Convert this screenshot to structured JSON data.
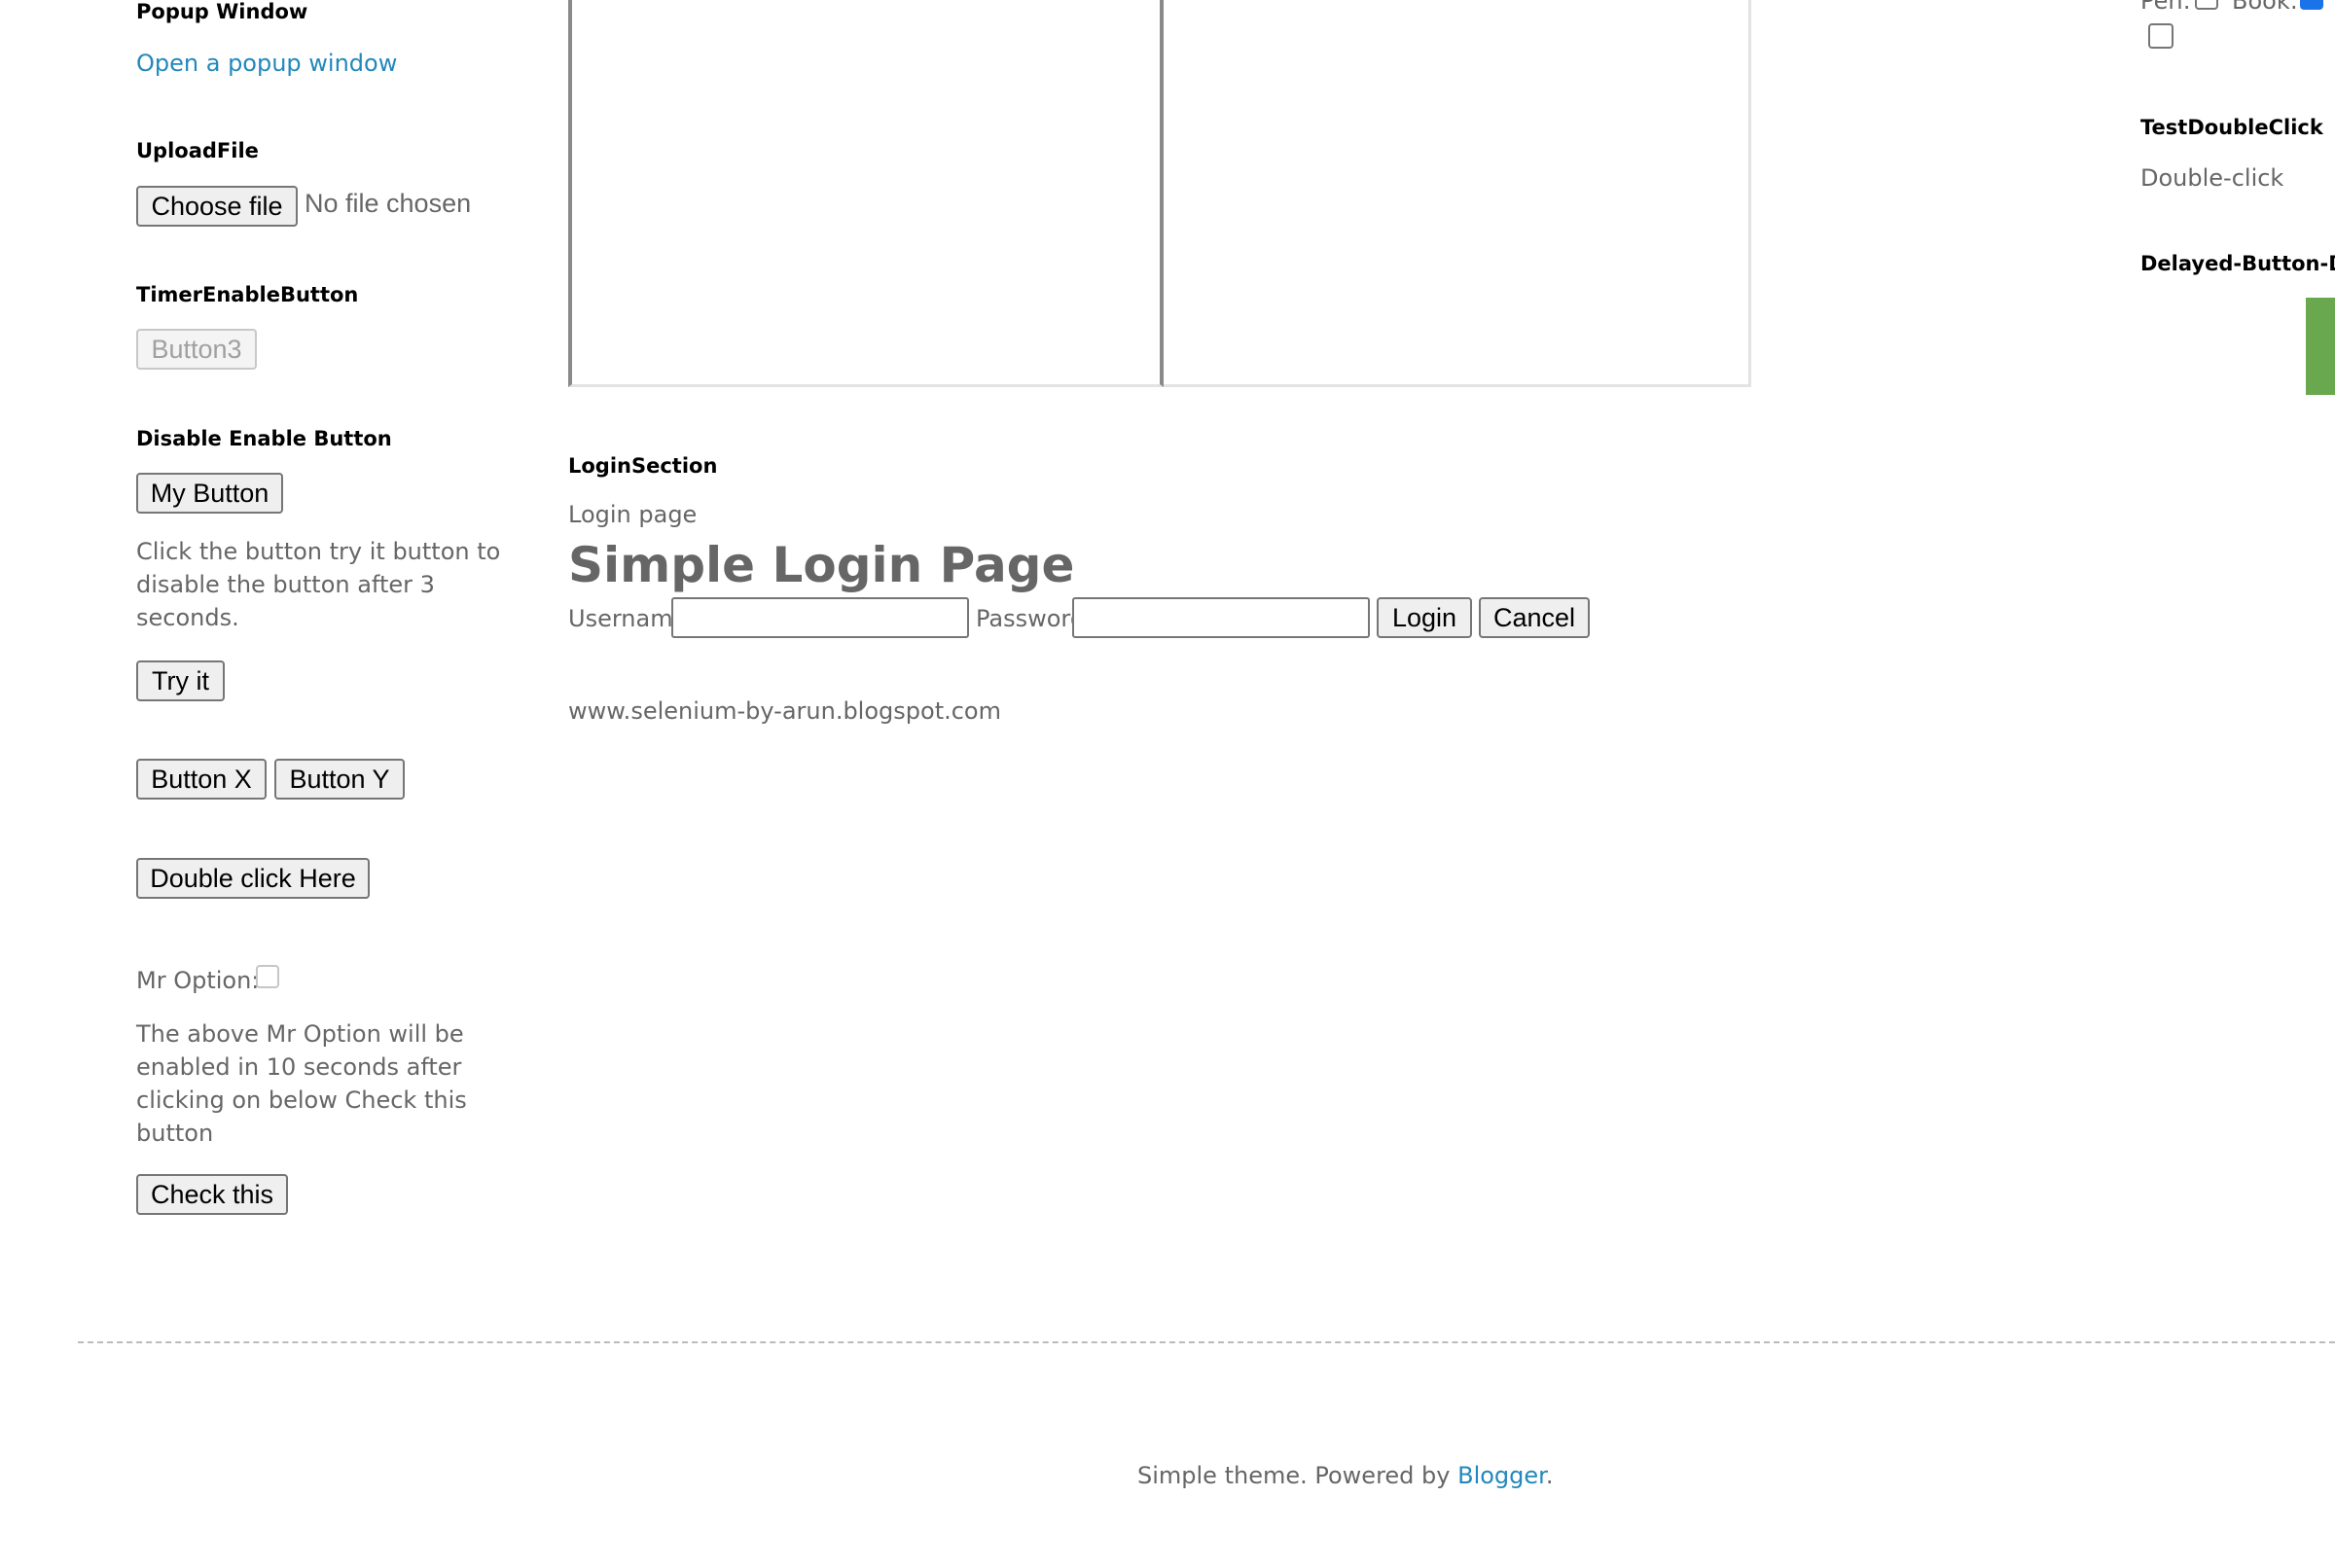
{
  "left_sidebar": {
    "popup": {
      "title": "Popup Window",
      "link_text": "Open a popup window"
    },
    "upload": {
      "title": "UploadFile",
      "button_label": "Choose file",
      "status": "No file chosen"
    },
    "timer": {
      "title": "TimerEnableButton",
      "button_label": "Button3"
    },
    "disable_enable": {
      "title": "Disable Enable Button",
      "my_button_label": "My Button",
      "description_lines": [
        "Click the button try it button to",
        "disable the button after 3",
        "seconds."
      ],
      "try_label": "Try it"
    },
    "button_x_label": "Button X",
    "button_y_label": "Button Y",
    "double_click_label": "Double click Here",
    "mr_option": {
      "label": "Mr Option:",
      "checked": false,
      "enabled": false,
      "description_lines": [
        "The above Mr Option will be",
        "enabled in 10 seconds after",
        "clicking on below Check this",
        "button"
      ],
      "check_label": "Check this"
    }
  },
  "main": {
    "login_section": {
      "title": "LoginSection",
      "subtitle": "Login page",
      "heading": "Simple Login Page",
      "username_label": "Username",
      "username_value": "",
      "password_label": "Password",
      "password_value": "",
      "login_label": "Login",
      "cancel_label": "Cancel"
    },
    "site_url": "www.selenium-by-arun.blogspot.com"
  },
  "right_sidebar": {
    "options": {
      "pen_label": "Pen:",
      "pen_checked": false,
      "book_label": "Book:",
      "book_checked": true,
      "extra_checked": false
    },
    "double_click": {
      "title": "TestDoubleClick",
      "text": "Double-click"
    },
    "delayed": {
      "title": "Delayed-Button-Dro"
    }
  },
  "footer": {
    "text": "Simple theme. Powered by ",
    "link_text": "Blogger",
    "suffix": "."
  },
  "colors": {
    "link": "#2288bb",
    "text": "#666666",
    "heading": "#000000",
    "accent_green": "#6aa84f",
    "checkbox_checked": "#1a73e8"
  }
}
